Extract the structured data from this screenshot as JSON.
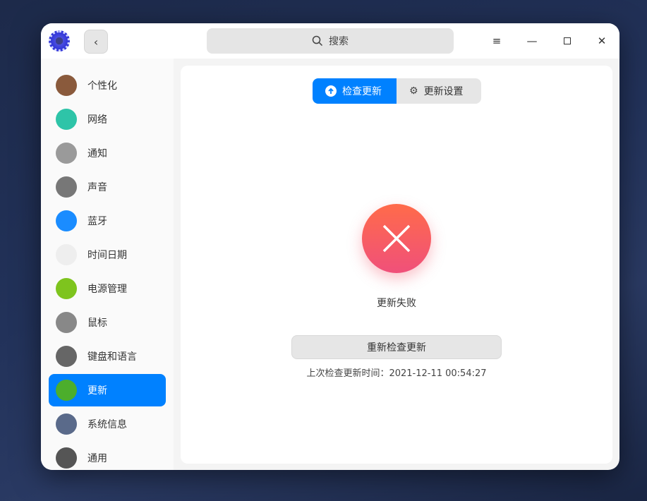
{
  "search": {
    "placeholder": "搜索"
  },
  "sidebar": {
    "items": [
      {
        "label": "个性化",
        "color": "#8a5a3c"
      },
      {
        "label": "网络",
        "color": "#2ec4a8"
      },
      {
        "label": "通知",
        "color": "#9a9a9a"
      },
      {
        "label": "声音",
        "color": "#777777"
      },
      {
        "label": "蓝牙",
        "color": "#1a8cff"
      },
      {
        "label": "时间日期",
        "color": "#eeeeee"
      },
      {
        "label": "电源管理",
        "color": "#7ec41e"
      },
      {
        "label": "鼠标",
        "color": "#888888"
      },
      {
        "label": "键盘和语言",
        "color": "#666666"
      },
      {
        "label": "更新",
        "color": "#4cae2c"
      },
      {
        "label": "系统信息",
        "color": "#5a6a8a"
      },
      {
        "label": "通用",
        "color": "#555555"
      }
    ],
    "selected_index": 9
  },
  "tabs": [
    {
      "label": "检查更新",
      "active": true
    },
    {
      "label": "更新设置",
      "active": false
    }
  ],
  "status": "更新失败",
  "retry_label": "重新检查更新",
  "last_check": "上次检查更新时间：2021-12-11 00:54:27"
}
